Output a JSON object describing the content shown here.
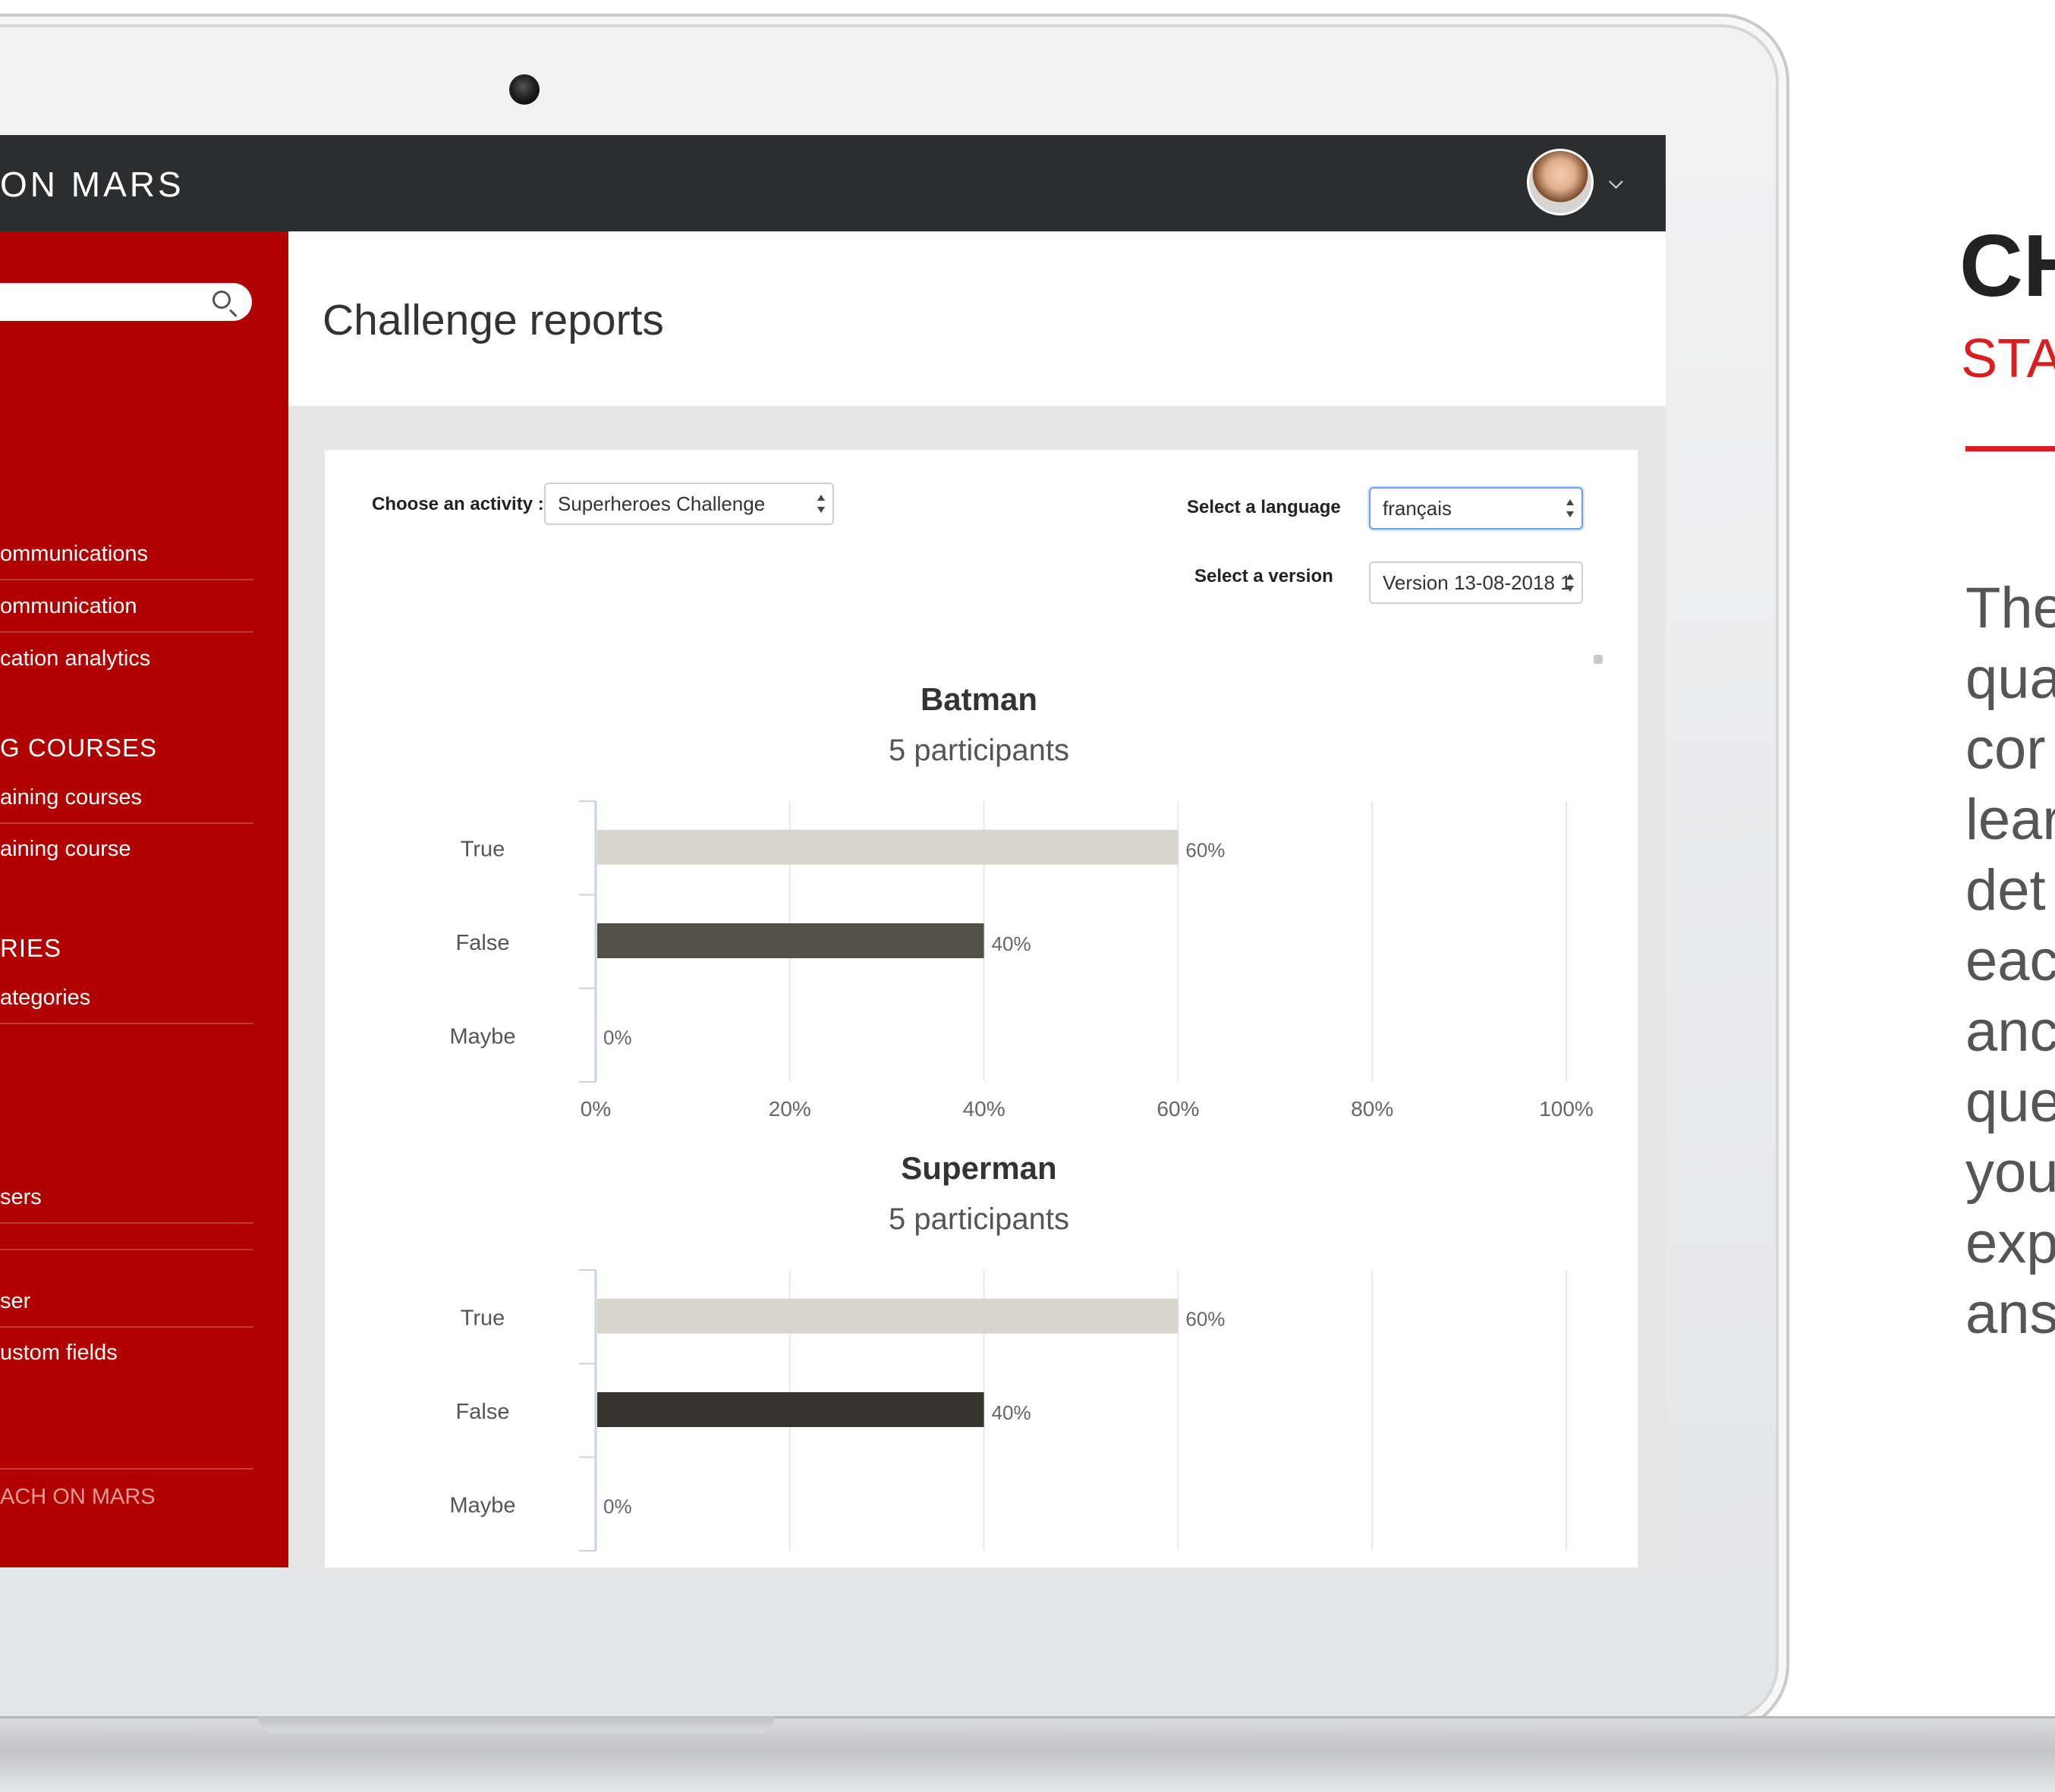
{
  "app": {
    "brand": "ON MARS"
  },
  "header": {
    "page_title": "Challenge reports"
  },
  "sidebar": {
    "search_placeholder": "",
    "items": [
      {
        "label": "ommunications"
      },
      {
        "label": "ommunication"
      },
      {
        "label": "cation analytics"
      }
    ],
    "section_courses": "G COURSES",
    "course_items": [
      {
        "label": "aining courses"
      },
      {
        "label": "aining course"
      }
    ],
    "section_categories": "RIES",
    "category_items": [
      {
        "label": "ategories"
      }
    ],
    "user_items": [
      {
        "label": "sers"
      },
      {
        "label": ""
      },
      {
        "label": "ser"
      },
      {
        "label": "ustom fields"
      }
    ],
    "footer": "ACH ON MARS"
  },
  "filters": {
    "activity_label": "Choose an activity :",
    "activity_value": "Superheroes Challenge",
    "language_label": "Select a language",
    "language_value": "français",
    "version_label": "Select a version",
    "version_value": "Version 13-08-2018 1"
  },
  "colors": {
    "topbar": "#2b2d2f",
    "sidebar": "#b00000",
    "accent": "#d81e1e",
    "bar_true": "#d8d5cb",
    "bar_false_batman": "#545148",
    "bar_false_superman": "#36342d"
  },
  "chart_data": [
    {
      "type": "bar",
      "orientation": "horizontal",
      "title": "Batman",
      "subtitle": "5 participants",
      "categories": [
        "True",
        "False",
        "Maybe"
      ],
      "values": [
        60,
        40,
        0
      ],
      "value_labels": [
        "60%",
        "40%",
        "0%"
      ],
      "xticks": [
        "0%",
        "20%",
        "40%",
        "60%",
        "80%",
        "100%"
      ],
      "xlim": [
        0,
        100
      ],
      "grid": true
    },
    {
      "type": "bar",
      "orientation": "horizontal",
      "title": "Superman",
      "subtitle": "5 participants",
      "categories": [
        "True",
        "False",
        "Maybe"
      ],
      "values": [
        60,
        40,
        0
      ],
      "value_labels": [
        "60%",
        "40%",
        "0%"
      ],
      "xticks": [],
      "xlim": [
        0,
        100
      ],
      "grid": true
    }
  ],
  "promo": {
    "title": "CH",
    "subtitle": "STA",
    "lines": [
      "The",
      "qua",
      "cor",
      "lear",
      "det",
      "eac",
      "anc",
      "que",
      "you",
      "exp",
      "ans"
    ]
  }
}
